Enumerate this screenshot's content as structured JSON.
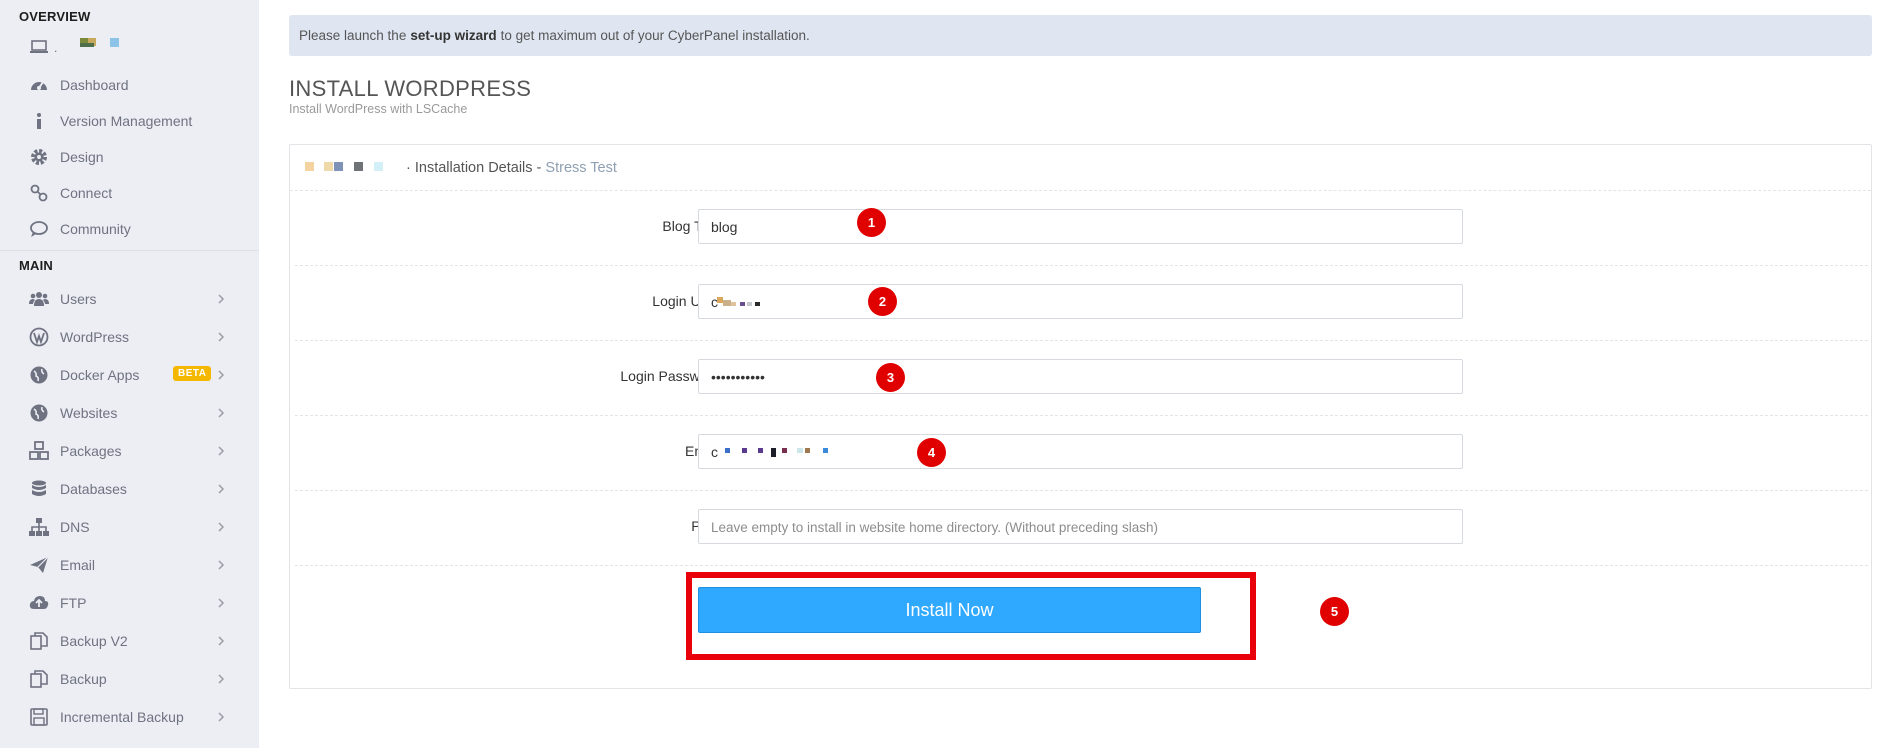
{
  "sidebar": {
    "overview_title": "OVERVIEW",
    "overview_user_prefix": ".",
    "overview_items": [
      {
        "label": "Dashboard",
        "icon": "dashboard-icon"
      },
      {
        "label": "Version Management",
        "icon": "info-icon"
      },
      {
        "label": "Design",
        "icon": "gear-icon"
      },
      {
        "label": "Connect",
        "icon": "link-icon"
      },
      {
        "label": "Community",
        "icon": "comments-icon"
      }
    ],
    "main_title": "MAIN",
    "main_items": [
      {
        "label": "Users",
        "icon": "users-icon"
      },
      {
        "label": "WordPress",
        "icon": "wordpress-icon"
      },
      {
        "label": "Docker Apps",
        "icon": "globe-icon",
        "badge": "BETA"
      },
      {
        "label": "Websites",
        "icon": "globe-icon"
      },
      {
        "label": "Packages",
        "icon": "cubes-icon"
      },
      {
        "label": "Databases",
        "icon": "database-icon"
      },
      {
        "label": "DNS",
        "icon": "sitemap-icon"
      },
      {
        "label": "Email",
        "icon": "paper-plane-icon"
      },
      {
        "label": "FTP",
        "icon": "cloud-upload-icon"
      },
      {
        "label": "Backup V2",
        "icon": "copy-icon"
      },
      {
        "label": "Backup",
        "icon": "copy-icon"
      },
      {
        "label": "Incremental Backup",
        "icon": "save-icon"
      }
    ]
  },
  "alert": {
    "prefix": "Please launch the",
    "link": "set-up wizard",
    "suffix": "to get maximum out of your CyberPanel installation."
  },
  "page": {
    "title": "INSTALL WORDPRESS",
    "subtitle": "Install WordPress with LSCache"
  },
  "panel": {
    "title_prefix": "· Installation Details -",
    "site_name": "Stress Test"
  },
  "form": {
    "blog_title_label": "Blog Title",
    "blog_title_value": "blog",
    "login_user_label": "Login User",
    "login_user_value": "c",
    "login_password_label": "Login Password",
    "login_password_value": "•••••••••••",
    "email_label": "Email",
    "email_value": "c",
    "path_label": "Path",
    "path_placeholder": "Leave empty to install in website home directory. (Without preceding slash)",
    "install_button": "Install Now"
  },
  "markers": [
    "1",
    "2",
    "3",
    "4",
    "5"
  ],
  "colors": {
    "sidebar_bg": "#eceef4",
    "alert_bg": "#dfe6f1",
    "button": "#2fa8ff",
    "highlight": "#e8000b",
    "badge": "#f5b800"
  }
}
